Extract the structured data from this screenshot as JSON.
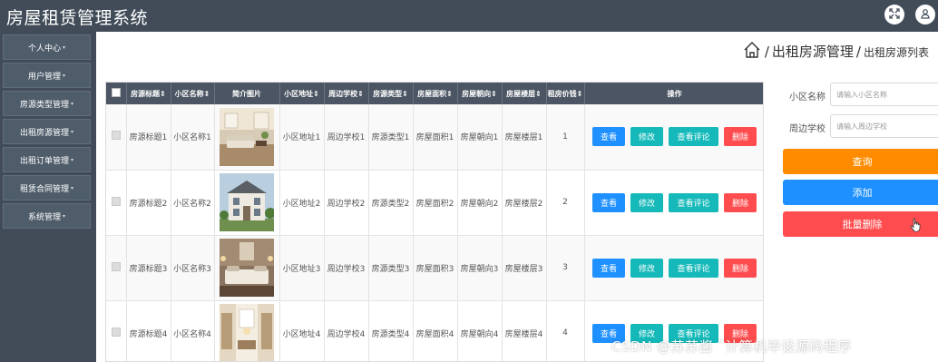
{
  "app": {
    "title": "房屋租赁管理系统"
  },
  "topbar": {
    "icons": [
      "fullscreen-icon",
      "user-icon"
    ]
  },
  "sidebar": {
    "items": [
      {
        "label": "个人中心"
      },
      {
        "label": "用户管理"
      },
      {
        "label": "房源类型管理"
      },
      {
        "label": "出租房源管理"
      },
      {
        "label": "出租订单管理"
      },
      {
        "label": "租赁合同管理"
      },
      {
        "label": "系统管理"
      }
    ]
  },
  "breadcrumb": {
    "sep1": "/",
    "item1": "出租房源管理",
    "sep2": "/",
    "item2": "出租房源列表"
  },
  "table": {
    "headers": [
      "房源标题",
      "小区名称",
      "简介图片",
      "小区地址",
      "周边学校",
      "房源类型",
      "房屋面积",
      "房屋朝向",
      "房屋楼层",
      "租房价钱",
      "操作"
    ],
    "sort_mark": "⇕",
    "rows": [
      {
        "title": "房源标题1",
        "community": "小区名称1",
        "image": "living-room",
        "address": "小区地址1",
        "school": "周边学校1",
        "type": "房源类型1",
        "area": "房屋面积1",
        "orientation": "房屋朝向1",
        "floor": "房屋楼层1",
        "price": "1"
      },
      {
        "title": "房源标题2",
        "community": "小区名称2",
        "image": "villa-exterior",
        "address": "小区地址2",
        "school": "周边学校2",
        "type": "房源类型2",
        "area": "房屋面积2",
        "orientation": "房屋朝向2",
        "floor": "房屋楼层2",
        "price": "2"
      },
      {
        "title": "房源标题3",
        "community": "小区名称3",
        "image": "bedroom",
        "address": "小区地址3",
        "school": "周边学校3",
        "type": "房源类型3",
        "area": "房屋面积3",
        "orientation": "房屋朝向3",
        "floor": "房屋楼层3",
        "price": "3"
      },
      {
        "title": "房源标题4",
        "community": "小区名称4",
        "image": "interior-hall",
        "address": "小区地址4",
        "school": "周边学校4",
        "type": "房源类型4",
        "area": "房屋面积4",
        "orientation": "房屋朝向4",
        "floor": "房屋楼层4",
        "price": "4"
      }
    ],
    "actions": {
      "view": "查看",
      "edit": "修改",
      "comments": "查看评论",
      "delete": "删除"
    }
  },
  "search": {
    "community_label": "小区名称",
    "community_placeholder": "请输入小区名称",
    "school_label": "周边学校",
    "school_placeholder": "请输入周边学校",
    "query_label": "查询",
    "add_label": "添加",
    "batch_delete_label": "批量删除"
  },
  "colors": {
    "header_bg": "#414c58",
    "view": "#1e90ff",
    "edit": "#15b9b9",
    "delete": "#ff4d4f",
    "query": "#ff8c00"
  },
  "watermark": "CSDN @苏苏酱   ˇ计算机毕设源码程序"
}
